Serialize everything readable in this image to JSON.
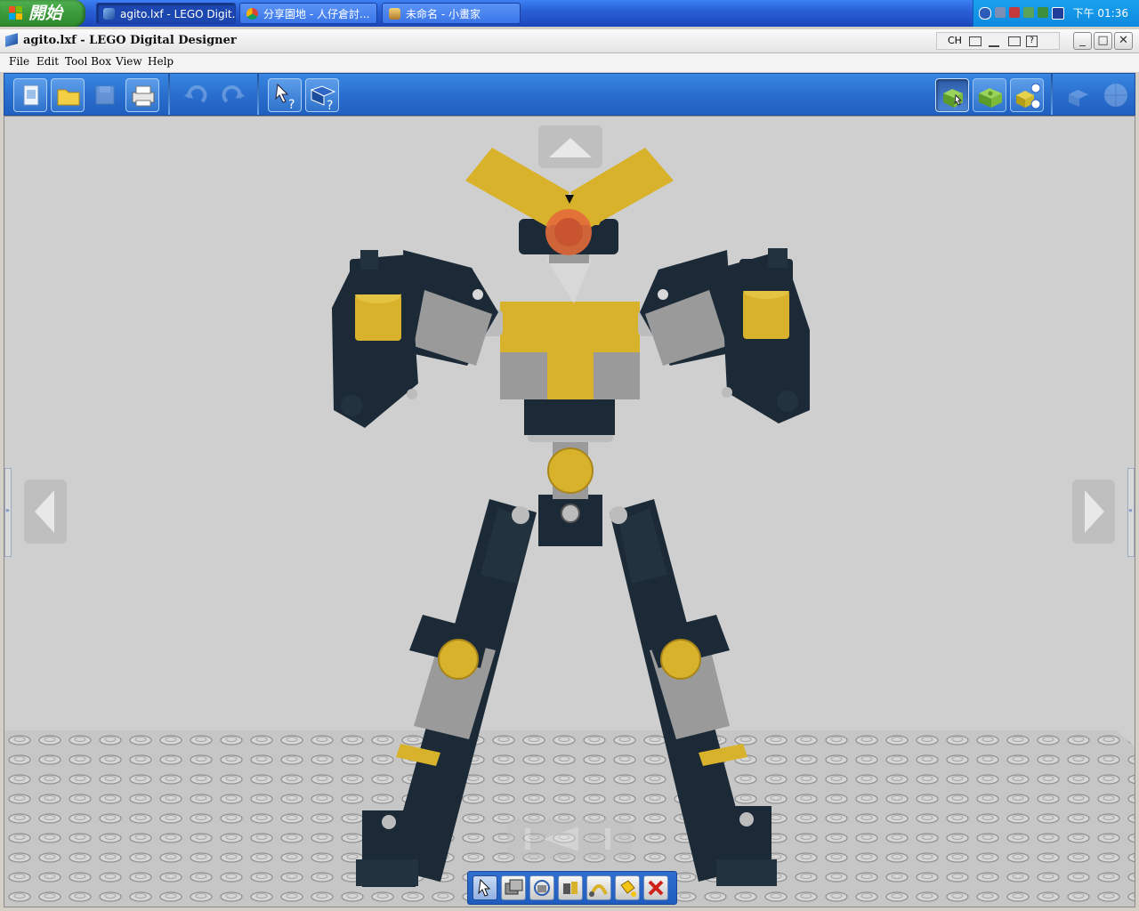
{
  "taskbar": {
    "start_label": "開始",
    "tasks": [
      {
        "label": "agito.lxf - LEGO Digit...",
        "icon": "lego-designer-icon",
        "active": true
      },
      {
        "label": "分享園地 - 人仔倉討...",
        "icon": "chrome-icon",
        "active": false
      },
      {
        "label": "未命名 - 小畫家",
        "icon": "paint-icon",
        "active": false
      }
    ],
    "tray_clock": "下午 01:36"
  },
  "window": {
    "title": "agito.lxf - LEGO Digital Designer",
    "lang_indicator": "CH",
    "minimize": "_",
    "maximize": "□",
    "close": "✕"
  },
  "menu": [
    "File",
    "Edit",
    "Tool Box",
    "View",
    "Help"
  ],
  "toolbar": {
    "file_buttons": [
      "new-file-icon",
      "open-folder-icon",
      "save-icon",
      "print-icon"
    ],
    "history_buttons": [
      "undo-icon",
      "redo-icon"
    ],
    "help_buttons": [
      "help-pointer-icon",
      "guide-book-icon"
    ],
    "mode_buttons": [
      "build-mode-icon",
      "view-mode-icon",
      "building-guide-mode-icon"
    ],
    "share_buttons": [
      "share-icon",
      "globe-icon"
    ]
  },
  "bottom_tools": [
    "select-arrow-icon",
    "clone-icon",
    "hinge-icon",
    "hinge-align-icon",
    "flex-icon",
    "paint-bucket-icon",
    "delete-icon"
  ],
  "colors": {
    "accent_blue": "#2a6fcf",
    "brick_dark": "#1b2a36",
    "brick_yellow": "#d8b22a",
    "brick_gray": "#9a9a9a",
    "canvas": "#cfcfcf",
    "delete_red": "#d0201a"
  }
}
